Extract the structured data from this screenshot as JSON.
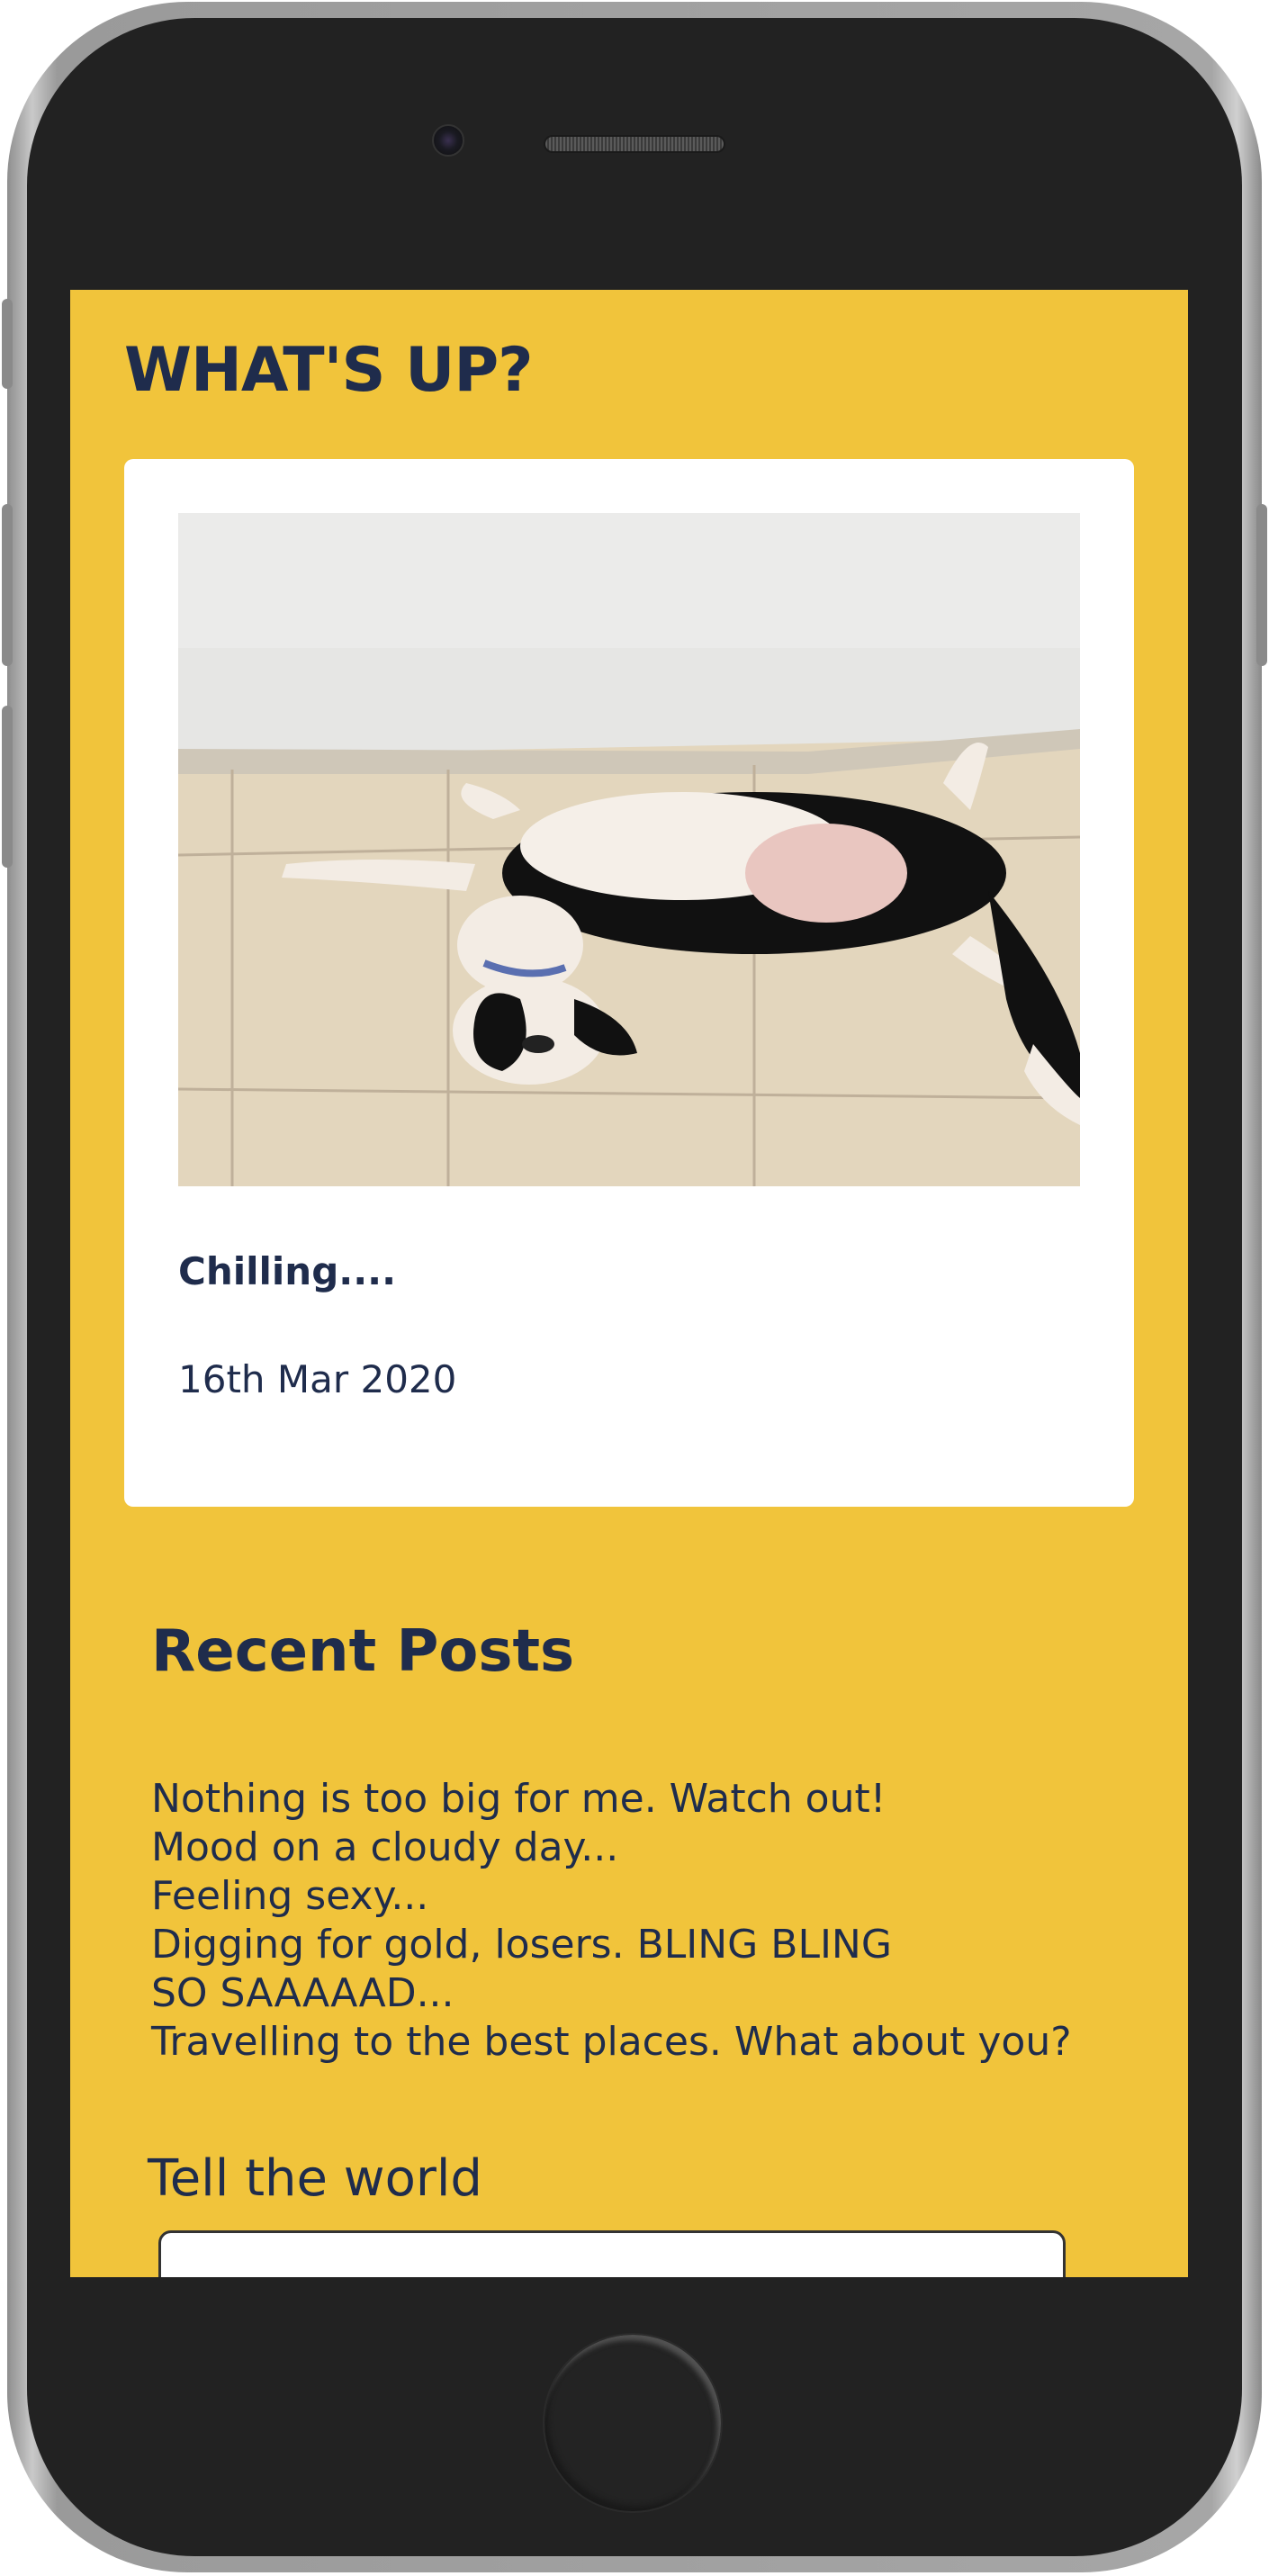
{
  "page": {
    "title": "WHAT'S UP?"
  },
  "post": {
    "caption": "Chilling....",
    "date": "16th Mar 2020"
  },
  "recent": {
    "title": "Recent Posts",
    "items": [
      "Nothing is too big for me. Watch out!",
      "Mood on a cloudy day...",
      "Feeling sexy...",
      "Digging for gold, losers. BLING BLING",
      "SO SAAAAAD...",
      "Travelling to the best places. What about you?"
    ]
  },
  "compose": {
    "label": "Tell the world",
    "value": ""
  },
  "colors": {
    "background": "#f1c43b",
    "text": "#1f2c4c",
    "card": "#ffffff"
  }
}
